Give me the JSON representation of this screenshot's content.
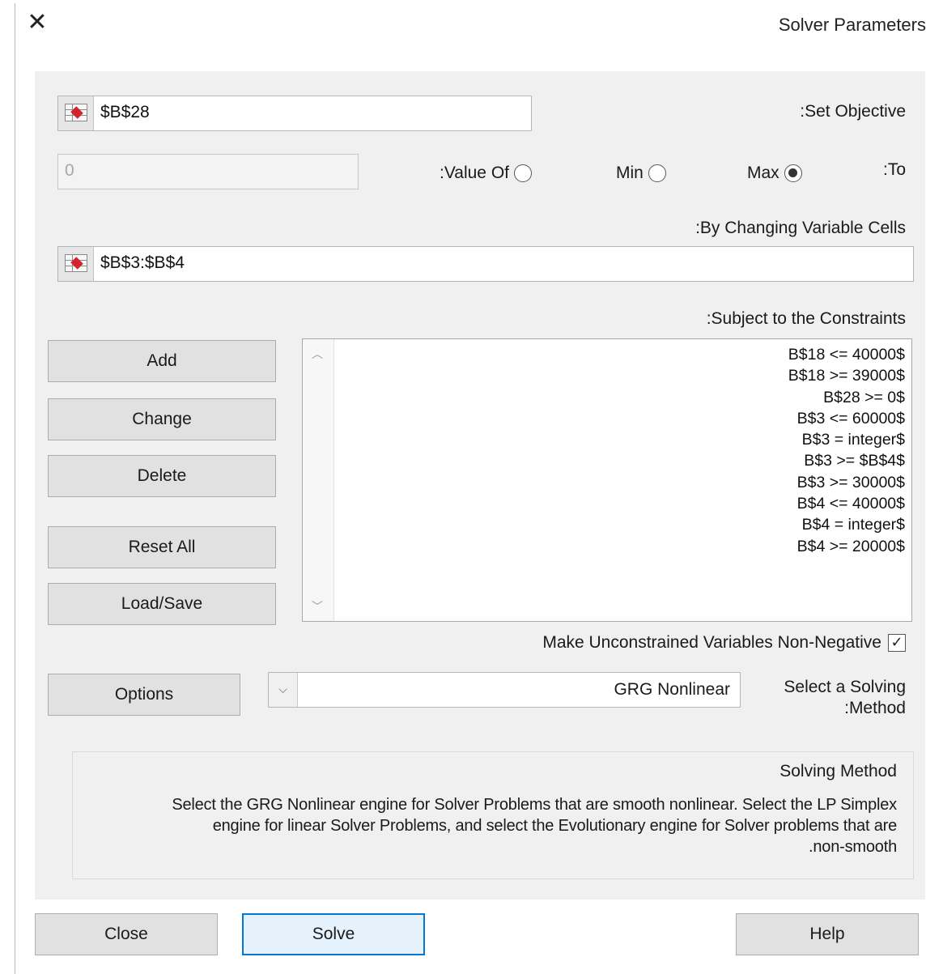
{
  "window": {
    "title": "Solver Parameters",
    "close_icon": "close-icon"
  },
  "objective": {
    "label": ":Set Objective",
    "value": "$B$28"
  },
  "to": {
    "label": ":To",
    "options": {
      "max": "Max",
      "min": "Min",
      "value_of": ":Value Of"
    },
    "selected": "Max",
    "value_of_input": "0"
  },
  "variables": {
    "label": ":By Changing Variable Cells",
    "value": "$B$3:$B$4"
  },
  "constraints": {
    "label": ":Subject to the Constraints",
    "items": [
      "B$18 <= 40000$",
      "B$18 >= 39000$",
      "B$28 >= 0$",
      "B$3 <= 60000$",
      "B$3 = integer$",
      "B$3 >= $B$4$",
      "B$3 >= 30000$",
      "B$4 <= 40000$",
      "B$4 = integer$",
      "B$4 >= 20000$"
    ],
    "scroll_icons": {
      "up": "chevron-up-icon",
      "down": "chevron-down-icon"
    }
  },
  "side_buttons": {
    "add": "Add",
    "change": "Change",
    "delete": "Delete",
    "reset_all": "Reset All",
    "load_save": "Load/Save"
  },
  "non_negative": {
    "label": "Make Unconstrained Variables Non-Negative",
    "checked": true
  },
  "method": {
    "label_line1": "Select a Solving",
    "label_line2": ":Method",
    "selected": "GRG Nonlinear",
    "options_button": "Options"
  },
  "solving_method": {
    "title": "Solving Method",
    "line1": "Select the GRG Nonlinear engine for Solver Problems that are smooth nonlinear. Select the LP Simplex",
    "line2": "engine for linear Solver Problems, and select the Evolutionary engine for Solver problems that are",
    "line3": ".non-smooth"
  },
  "footer": {
    "close": "Close",
    "solve": "Solve",
    "help": "Help"
  },
  "colors": {
    "panel": "#f0f0f0",
    "accent": "#0078d7",
    "ref_arrow": "#d2242a"
  }
}
